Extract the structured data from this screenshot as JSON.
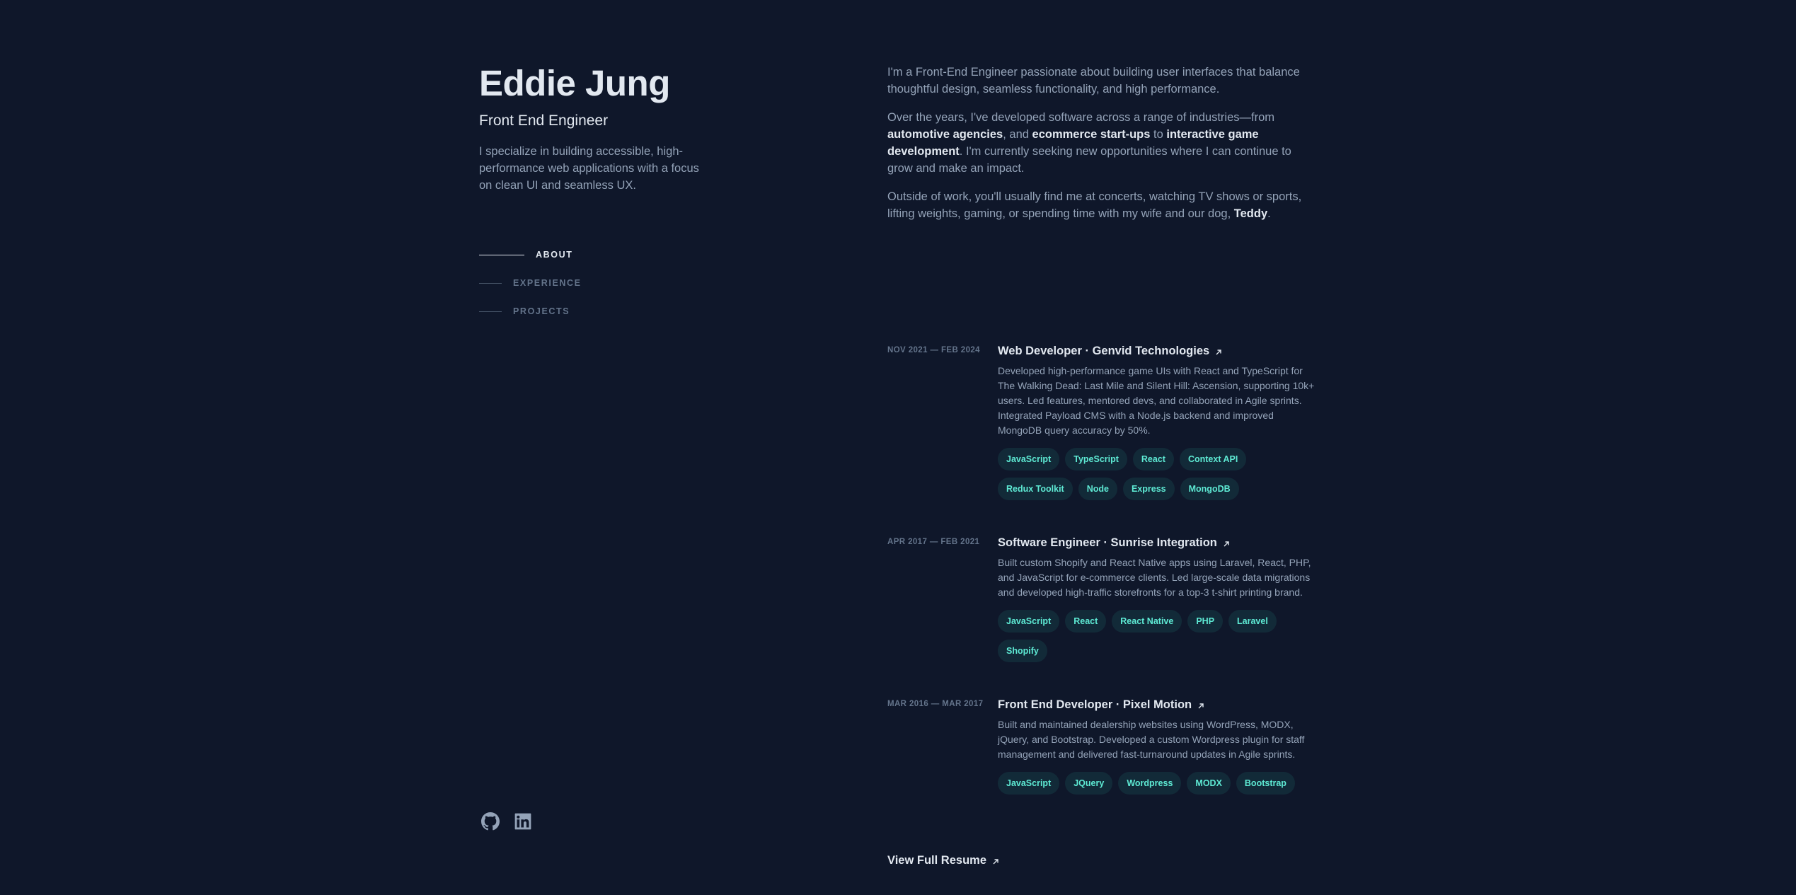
{
  "header": {
    "name": "Eddie Jung",
    "role": "Front End Engineer",
    "tagline": "I specialize in building accessible, high-performance web applications with a focus on clean UI and seamless UX."
  },
  "nav": [
    {
      "label": "ABOUT",
      "active": true
    },
    {
      "label": "EXPERIENCE",
      "active": false
    },
    {
      "label": "PROJECTS",
      "active": false
    }
  ],
  "social": [
    {
      "icon": "github-icon"
    },
    {
      "icon": "linkedin-icon"
    }
  ],
  "about": {
    "p1": "I'm a Front-End Engineer passionate about building user interfaces that balance thoughtful design, seamless functionality, and high performance.",
    "p2": {
      "t1": "Over the years, I've developed software across a range of industries—from ",
      "h1": "automotive agencies",
      "t2": ", and ",
      "h2": "ecommerce start-ups",
      "t3": " to ",
      "h3": "interactive game development",
      "t4": ". I'm currently seeking new opportunities where I can continue to grow and make an impact."
    },
    "p3": {
      "t1": "Outside of work, you'll usually find me at concerts, watching TV shows or sports, lifting weights, gaming, or spending time with my wife and our dog, ",
      "h1": "Teddy",
      "t2": "."
    }
  },
  "experience": [
    {
      "date": "NOV 2021 — FEB 2024",
      "title": "Web Developer · Genvid Technologies",
      "description": "Developed high-performance game UIs with React and TypeScript for The Walking Dead: Last Mile and Silent Hill: Ascension, supporting 10k+ users. Led features, mentored devs, and collaborated in Agile sprints. Integrated Payload CMS with a Node.js backend and improved MongoDB query accuracy by 50%.",
      "tags": [
        "JavaScript",
        "TypeScript",
        "React",
        "Context API",
        "Redux Toolkit",
        "Node",
        "Express",
        "MongoDB"
      ]
    },
    {
      "date": "APR 2017 — FEB 2021",
      "title": "Software Engineer · Sunrise Integration",
      "description": "Built custom Shopify and React Native apps using Laravel, React, PHP, and JavaScript for e-commerce clients. Led large-scale data migrations and developed high-traffic storefronts for a top-3 t-shirt printing brand.",
      "tags": [
        "JavaScript",
        "React",
        "React Native",
        "PHP",
        "Laravel",
        "Shopify"
      ]
    },
    {
      "date": "MAR 2016 — MAR 2017",
      "title": "Front End Developer · Pixel Motion",
      "description": "Built and maintained dealership websites using WordPress, MODX, jQuery, and Bootstrap. Developed a custom Wordpress plugin for staff management and delivered fast-turnaround updates in Agile sprints.",
      "tags": [
        "JavaScript",
        "JQuery",
        "Wordpress",
        "MODX",
        "Bootstrap"
      ]
    }
  ],
  "resume": {
    "label": "View Full Resume"
  },
  "colors": {
    "background": "#0f172a",
    "heading": "#e2e8f0",
    "body": "#94a3b8",
    "accent": "#5eead4"
  }
}
